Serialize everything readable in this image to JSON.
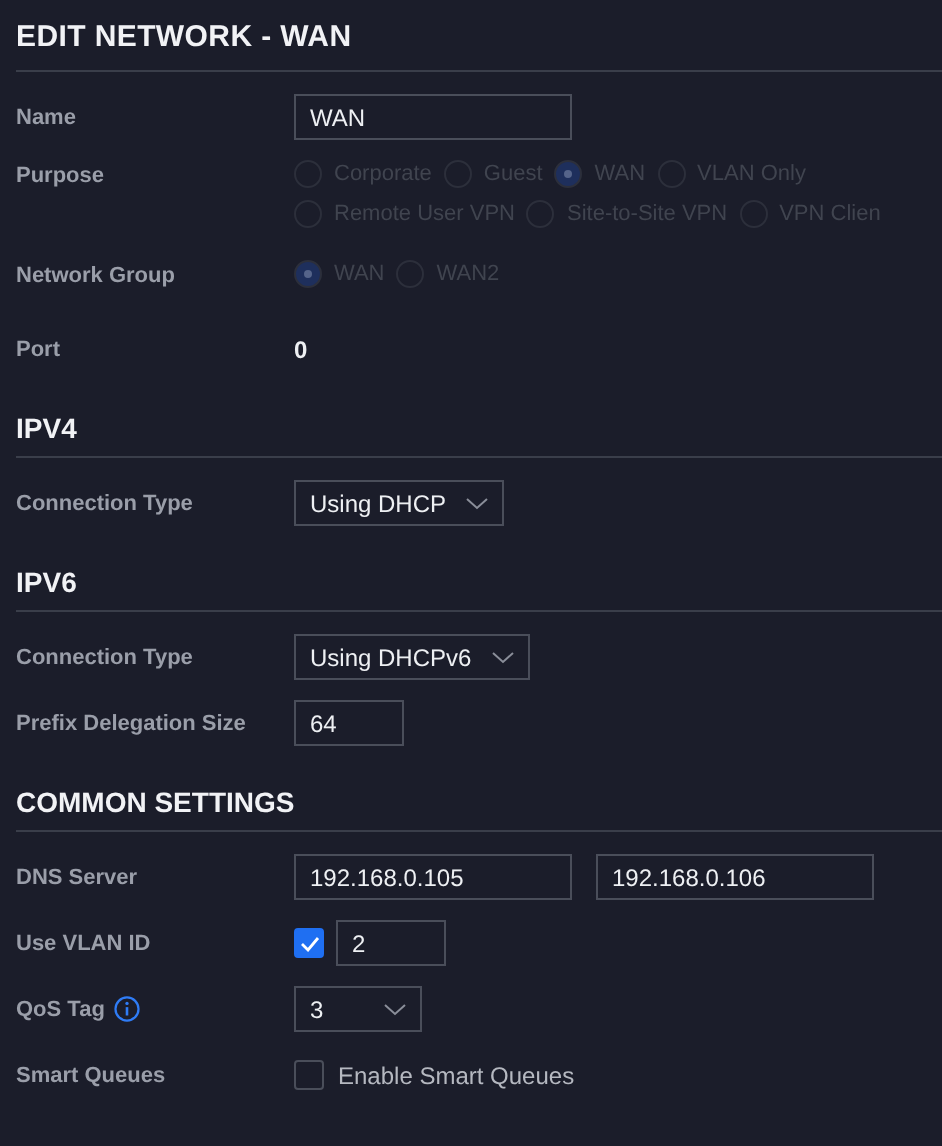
{
  "title": "EDIT NETWORK - WAN",
  "sections": [
    {
      "rows": [
        {
          "kind": "text",
          "label": "Name",
          "value": "WAN"
        },
        {
          "kind": "radios",
          "label": "Purpose",
          "disabled": true,
          "lines": [
            [
              {
                "label": "Corporate",
                "selected": false
              },
              {
                "label": "Guest",
                "selected": false
              },
              {
                "label": "WAN",
                "selected": true
              },
              {
                "label": "VLAN Only",
                "selected": false
              }
            ],
            [
              {
                "label": "Remote User VPN",
                "selected": false
              },
              {
                "label": "Site-to-Site VPN",
                "selected": false
              },
              {
                "label": "VPN Clien",
                "selected": false
              }
            ]
          ]
        },
        {
          "kind": "radios",
          "label": "Network Group",
          "disabled": true,
          "lines": [
            [
              {
                "label": "WAN",
                "selected": true
              },
              {
                "label": "WAN2",
                "selected": false
              }
            ]
          ]
        },
        {
          "kind": "static",
          "label": "Port",
          "value": "0"
        }
      ]
    },
    {
      "header": "IPV4",
      "rows": [
        {
          "kind": "select",
          "label": "Connection Type",
          "value": "Using DHCP"
        }
      ]
    },
    {
      "header": "IPV6",
      "rows": [
        {
          "kind": "select",
          "label": "Connection Type",
          "value": "Using DHCPv6"
        },
        {
          "kind": "number",
          "label": "Prefix Delegation Size",
          "value": "64"
        }
      ]
    },
    {
      "header": "COMMON SETTINGS",
      "rows": [
        {
          "kind": "pair",
          "label": "DNS Server",
          "values": [
            "192.168.0.105",
            "192.168.0.106"
          ]
        },
        {
          "kind": "check_input",
          "label": "Use VLAN ID",
          "checked": true,
          "value": "2"
        },
        {
          "kind": "select",
          "label": "QoS Tag",
          "info": true,
          "value": "3"
        },
        {
          "kind": "check_label",
          "label": "Smart Queues",
          "checked": false,
          "text": "Enable Smart Queues"
        }
      ]
    }
  ]
}
